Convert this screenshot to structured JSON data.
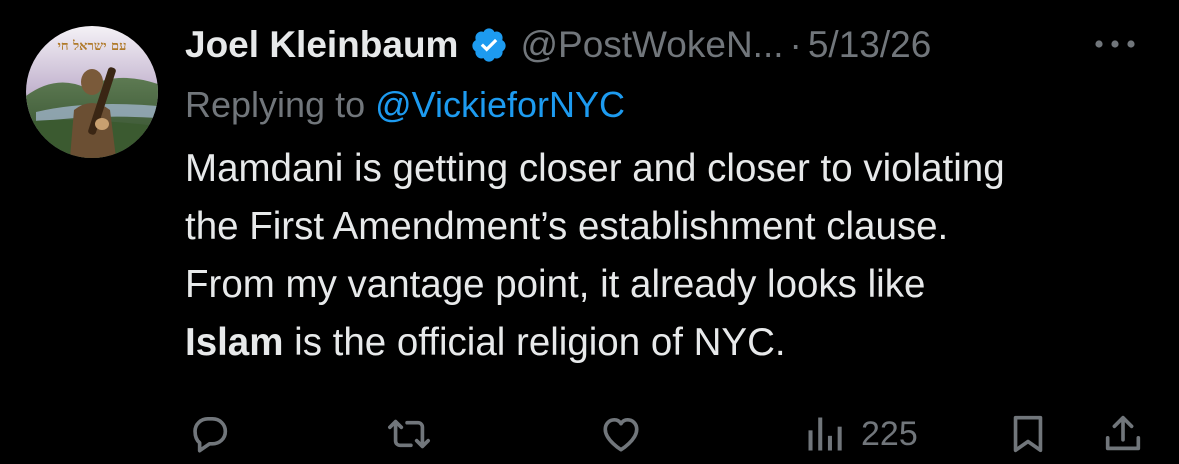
{
  "tweet": {
    "author_name": "Joel Kleinbaum",
    "handle": "@PostWokeN...",
    "separator": "·",
    "date": "5/13/26",
    "reply_prefix": "Replying to ",
    "reply_to": "@VickieforNYC",
    "text_lines": [
      "Mamdani is getting closer and closer to violating",
      "the First Amendment’s establishment clause.",
      "From my vantage point, it already looks like"
    ],
    "text_last_bold": "Islam",
    "text_last_rest": " is the official religion of NYC.",
    "avatar_caption": "עם ישראל חי"
  },
  "actions": {
    "views": "225"
  },
  "icons": {
    "verified": "verified-badge-icon",
    "more": "more-icon",
    "reply": "reply-icon",
    "retweet": "retweet-icon",
    "like": "heart-icon",
    "views": "views-icon",
    "bookmark": "bookmark-icon",
    "share": "share-icon"
  },
  "colors": {
    "background": "#000000",
    "primary_text": "#e7e9ea",
    "secondary_text": "#71767b",
    "link": "#1d9bf0",
    "verified": "#1d9bf0"
  }
}
